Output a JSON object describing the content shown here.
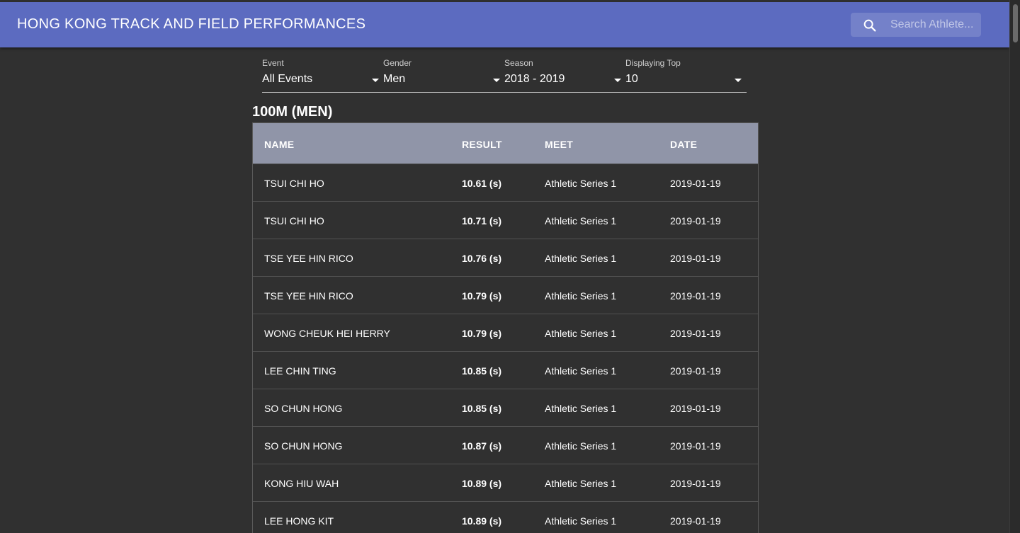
{
  "header": {
    "title": "HONG KONG TRACK AND FIELD PERFORMANCES",
    "search_placeholder": "Search Athlete..."
  },
  "filters": [
    {
      "label": "Event",
      "value": "All Events"
    },
    {
      "label": "Gender",
      "value": "Men"
    },
    {
      "label": "Season",
      "value": "2018 - 2019"
    },
    {
      "label": "Displaying Top",
      "value": "10"
    }
  ],
  "section": {
    "title": "100M (MEN)"
  },
  "table": {
    "columns": [
      "NAME",
      "RESULT",
      "MEET",
      "DATE"
    ],
    "rows": [
      {
        "name": "TSUI CHI HO",
        "result": "10.61 (s)",
        "meet": "Athletic Series 1",
        "date": "2019-01-19"
      },
      {
        "name": "TSUI CHI HO",
        "result": "10.71 (s)",
        "meet": "Athletic Series 1",
        "date": "2019-01-19"
      },
      {
        "name": "TSE YEE HIN RICO",
        "result": "10.76 (s)",
        "meet": "Athletic Series 1",
        "date": "2019-01-19"
      },
      {
        "name": "TSE YEE HIN RICO",
        "result": "10.79 (s)",
        "meet": "Athletic Series 1",
        "date": "2019-01-19"
      },
      {
        "name": "WONG CHEUK HEI HERRY",
        "result": "10.79 (s)",
        "meet": "Athletic Series 1",
        "date": "2019-01-19"
      },
      {
        "name": "LEE CHIN TING",
        "result": "10.85 (s)",
        "meet": "Athletic Series 1",
        "date": "2019-01-19"
      },
      {
        "name": "SO CHUN HONG",
        "result": "10.85 (s)",
        "meet": "Athletic Series 1",
        "date": "2019-01-19"
      },
      {
        "name": "SO CHUN HONG",
        "result": "10.87 (s)",
        "meet": "Athletic Series 1",
        "date": "2019-01-19"
      },
      {
        "name": "KONG HIU WAH",
        "result": "10.89 (s)",
        "meet": "Athletic Series 1",
        "date": "2019-01-19"
      },
      {
        "name": "LEE HONG KIT",
        "result": "10.89 (s)",
        "meet": "Athletic Series 1",
        "date": "2019-01-19"
      }
    ]
  },
  "colors": {
    "app_bar": "#5c6bc0",
    "background": "#303030",
    "table_header": "#9095a8"
  },
  "icons": {
    "search": "search-icon",
    "dropdown": "arrow-drop-down-icon"
  }
}
